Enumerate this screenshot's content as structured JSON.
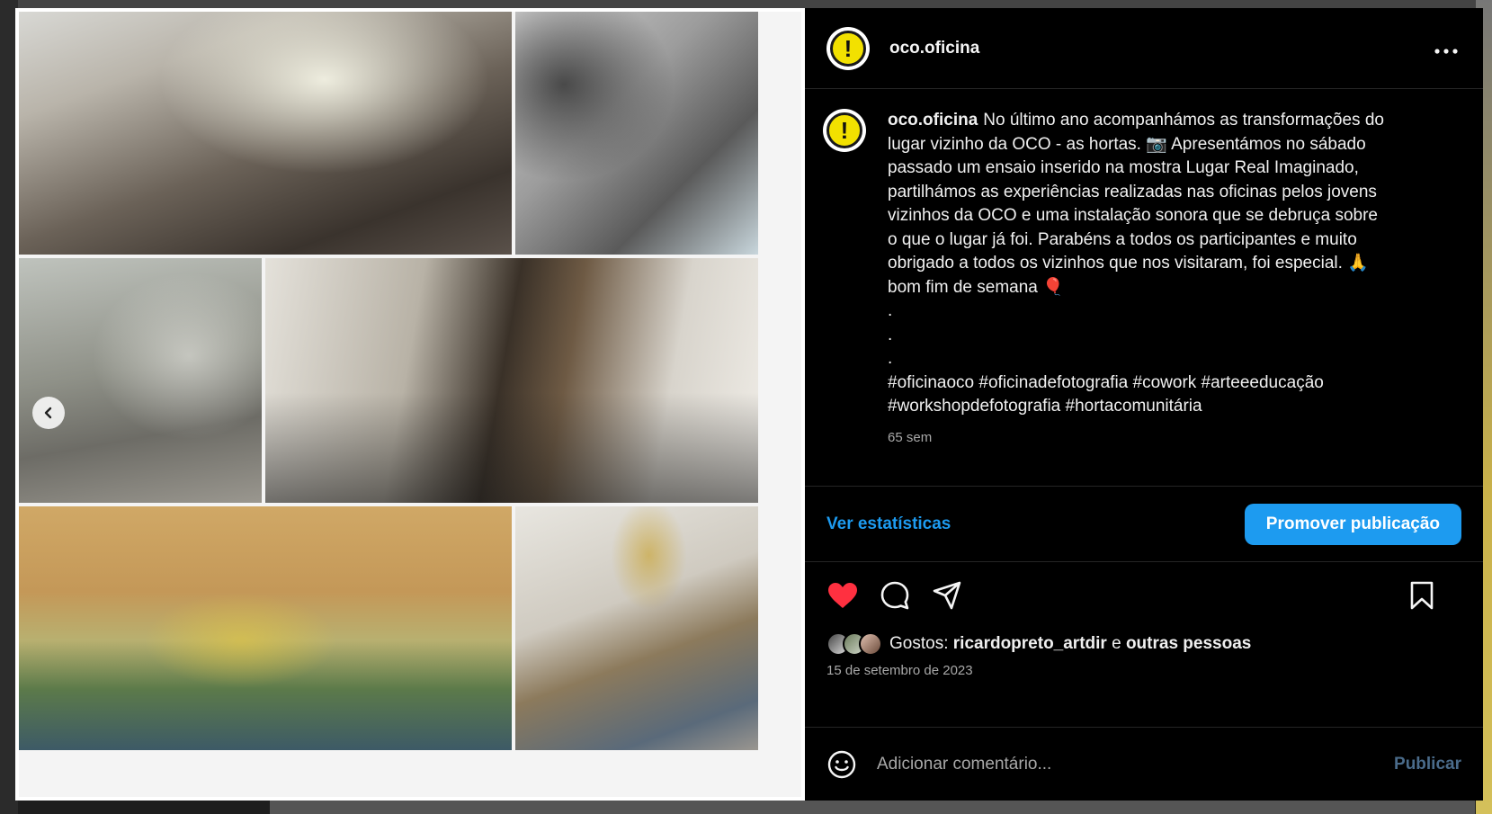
{
  "post": {
    "username": "oco.oficina",
    "caption": {
      "user": "oco.oficina",
      "lines": [
        "No último ano acompanhámos as transformações do",
        "lugar vizinho da OCO - as hortas. 📷 Apresentámos no sábado",
        "passado um ensaio inserido na mostra Lugar Real Imaginado,",
        "partilhámos as experiências realizadas nas oficinas pelos jovens",
        "vizinhos da OCO e uma instalação sonora que se debruça sobre",
        "o que o lugar já foi. Parabéns a todos os participantes e muito",
        "obrigado a todos os vizinhos que nos visitaram, foi especial. 🙏",
        "bom fim de semana 🎈",
        ".",
        ".",
        "."
      ],
      "hashtags_line1": "#oficinaoco #oficinadefotografia #cowork #arteeeducação",
      "hashtags_line2": "#workshopdefotografia #hortacomunitária"
    },
    "age": "65 sem",
    "stats_link": "Ver estatísticas",
    "promote_label": "Promover publicação",
    "likes": {
      "prefix": "Gostos:",
      "user": "ricardopreto_artdir",
      "connector": "e",
      "others": "outras pessoas"
    },
    "date": "15 de setembro de 2023",
    "comment_placeholder": "Adicionar comentário...",
    "publish_label": "Publicar",
    "liked": true
  },
  "icons": {
    "avatar": "oco-logo",
    "more": "more-horizontal-icon",
    "heart": "heart-filled-icon",
    "comment": "comment-icon",
    "share": "share-icon",
    "bookmark": "bookmark-icon",
    "emoji": "emoji-icon",
    "carousel_prev": "chevron-left-icon"
  },
  "colors": {
    "accent": "#1d9bf0",
    "like": "#ff3040",
    "avatar_yellow": "#f2e100"
  }
}
